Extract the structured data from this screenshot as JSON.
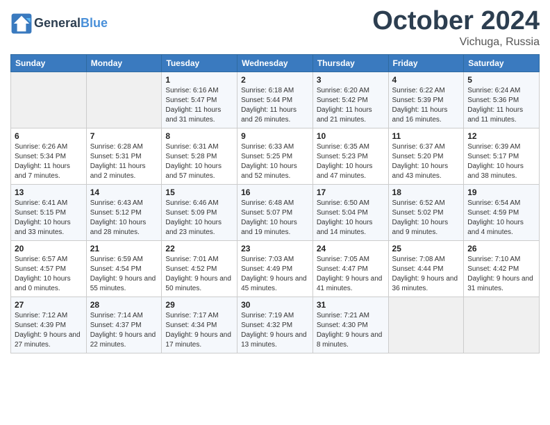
{
  "header": {
    "logo_line1": "General",
    "logo_line2": "Blue",
    "month": "October 2024",
    "location": "Vichuga, Russia"
  },
  "days_of_week": [
    "Sunday",
    "Monday",
    "Tuesday",
    "Wednesday",
    "Thursday",
    "Friday",
    "Saturday"
  ],
  "weeks": [
    [
      {
        "day": "",
        "sunrise": "",
        "sunset": "",
        "daylight": ""
      },
      {
        "day": "",
        "sunrise": "",
        "sunset": "",
        "daylight": ""
      },
      {
        "day": "1",
        "sunrise": "Sunrise: 6:16 AM",
        "sunset": "Sunset: 5:47 PM",
        "daylight": "Daylight: 11 hours and 31 minutes."
      },
      {
        "day": "2",
        "sunrise": "Sunrise: 6:18 AM",
        "sunset": "Sunset: 5:44 PM",
        "daylight": "Daylight: 11 hours and 26 minutes."
      },
      {
        "day": "3",
        "sunrise": "Sunrise: 6:20 AM",
        "sunset": "Sunset: 5:42 PM",
        "daylight": "Daylight: 11 hours and 21 minutes."
      },
      {
        "day": "4",
        "sunrise": "Sunrise: 6:22 AM",
        "sunset": "Sunset: 5:39 PM",
        "daylight": "Daylight: 11 hours and 16 minutes."
      },
      {
        "day": "5",
        "sunrise": "Sunrise: 6:24 AM",
        "sunset": "Sunset: 5:36 PM",
        "daylight": "Daylight: 11 hours and 11 minutes."
      }
    ],
    [
      {
        "day": "6",
        "sunrise": "Sunrise: 6:26 AM",
        "sunset": "Sunset: 5:34 PM",
        "daylight": "Daylight: 11 hours and 7 minutes."
      },
      {
        "day": "7",
        "sunrise": "Sunrise: 6:28 AM",
        "sunset": "Sunset: 5:31 PM",
        "daylight": "Daylight: 11 hours and 2 minutes."
      },
      {
        "day": "8",
        "sunrise": "Sunrise: 6:31 AM",
        "sunset": "Sunset: 5:28 PM",
        "daylight": "Daylight: 10 hours and 57 minutes."
      },
      {
        "day": "9",
        "sunrise": "Sunrise: 6:33 AM",
        "sunset": "Sunset: 5:25 PM",
        "daylight": "Daylight: 10 hours and 52 minutes."
      },
      {
        "day": "10",
        "sunrise": "Sunrise: 6:35 AM",
        "sunset": "Sunset: 5:23 PM",
        "daylight": "Daylight: 10 hours and 47 minutes."
      },
      {
        "day": "11",
        "sunrise": "Sunrise: 6:37 AM",
        "sunset": "Sunset: 5:20 PM",
        "daylight": "Daylight: 10 hours and 43 minutes."
      },
      {
        "day": "12",
        "sunrise": "Sunrise: 6:39 AM",
        "sunset": "Sunset: 5:17 PM",
        "daylight": "Daylight: 10 hours and 38 minutes."
      }
    ],
    [
      {
        "day": "13",
        "sunrise": "Sunrise: 6:41 AM",
        "sunset": "Sunset: 5:15 PM",
        "daylight": "Daylight: 10 hours and 33 minutes."
      },
      {
        "day": "14",
        "sunrise": "Sunrise: 6:43 AM",
        "sunset": "Sunset: 5:12 PM",
        "daylight": "Daylight: 10 hours and 28 minutes."
      },
      {
        "day": "15",
        "sunrise": "Sunrise: 6:46 AM",
        "sunset": "Sunset: 5:09 PM",
        "daylight": "Daylight: 10 hours and 23 minutes."
      },
      {
        "day": "16",
        "sunrise": "Sunrise: 6:48 AM",
        "sunset": "Sunset: 5:07 PM",
        "daylight": "Daylight: 10 hours and 19 minutes."
      },
      {
        "day": "17",
        "sunrise": "Sunrise: 6:50 AM",
        "sunset": "Sunset: 5:04 PM",
        "daylight": "Daylight: 10 hours and 14 minutes."
      },
      {
        "day": "18",
        "sunrise": "Sunrise: 6:52 AM",
        "sunset": "Sunset: 5:02 PM",
        "daylight": "Daylight: 10 hours and 9 minutes."
      },
      {
        "day": "19",
        "sunrise": "Sunrise: 6:54 AM",
        "sunset": "Sunset: 4:59 PM",
        "daylight": "Daylight: 10 hours and 4 minutes."
      }
    ],
    [
      {
        "day": "20",
        "sunrise": "Sunrise: 6:57 AM",
        "sunset": "Sunset: 4:57 PM",
        "daylight": "Daylight: 10 hours and 0 minutes."
      },
      {
        "day": "21",
        "sunrise": "Sunrise: 6:59 AM",
        "sunset": "Sunset: 4:54 PM",
        "daylight": "Daylight: 9 hours and 55 minutes."
      },
      {
        "day": "22",
        "sunrise": "Sunrise: 7:01 AM",
        "sunset": "Sunset: 4:52 PM",
        "daylight": "Daylight: 9 hours and 50 minutes."
      },
      {
        "day": "23",
        "sunrise": "Sunrise: 7:03 AM",
        "sunset": "Sunset: 4:49 PM",
        "daylight": "Daylight: 9 hours and 45 minutes."
      },
      {
        "day": "24",
        "sunrise": "Sunrise: 7:05 AM",
        "sunset": "Sunset: 4:47 PM",
        "daylight": "Daylight: 9 hours and 41 minutes."
      },
      {
        "day": "25",
        "sunrise": "Sunrise: 7:08 AM",
        "sunset": "Sunset: 4:44 PM",
        "daylight": "Daylight: 9 hours and 36 minutes."
      },
      {
        "day": "26",
        "sunrise": "Sunrise: 7:10 AM",
        "sunset": "Sunset: 4:42 PM",
        "daylight": "Daylight: 9 hours and 31 minutes."
      }
    ],
    [
      {
        "day": "27",
        "sunrise": "Sunrise: 7:12 AM",
        "sunset": "Sunset: 4:39 PM",
        "daylight": "Daylight: 9 hours and 27 minutes."
      },
      {
        "day": "28",
        "sunrise": "Sunrise: 7:14 AM",
        "sunset": "Sunset: 4:37 PM",
        "daylight": "Daylight: 9 hours and 22 minutes."
      },
      {
        "day": "29",
        "sunrise": "Sunrise: 7:17 AM",
        "sunset": "Sunset: 4:34 PM",
        "daylight": "Daylight: 9 hours and 17 minutes."
      },
      {
        "day": "30",
        "sunrise": "Sunrise: 7:19 AM",
        "sunset": "Sunset: 4:32 PM",
        "daylight": "Daylight: 9 hours and 13 minutes."
      },
      {
        "day": "31",
        "sunrise": "Sunrise: 7:21 AM",
        "sunset": "Sunset: 4:30 PM",
        "daylight": "Daylight: 9 hours and 8 minutes."
      },
      {
        "day": "",
        "sunrise": "",
        "sunset": "",
        "daylight": ""
      },
      {
        "day": "",
        "sunrise": "",
        "sunset": "",
        "daylight": ""
      }
    ]
  ]
}
